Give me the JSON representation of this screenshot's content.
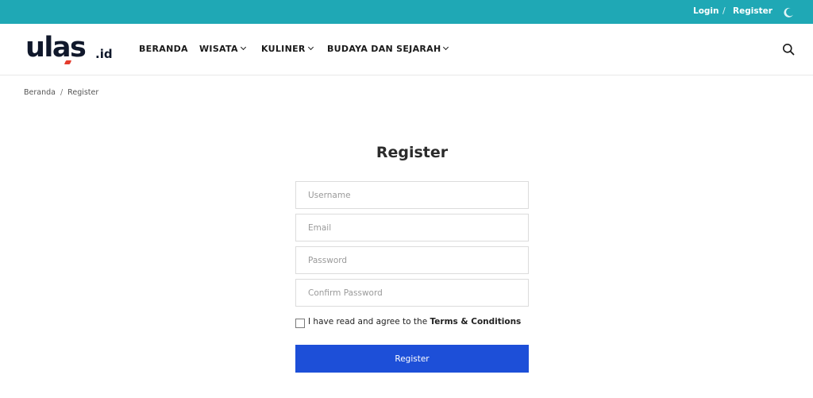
{
  "topbar": {
    "login": "Login",
    "separator": "/",
    "register": "Register",
    "theme_icon": "moon-icon"
  },
  "header": {
    "logo": {
      "main": "ulas",
      "tld": ".id"
    },
    "nav": [
      {
        "label": "BERANDA",
        "dropdown": false
      },
      {
        "label": "WISATA",
        "dropdown": true
      },
      {
        "label": "KULINER",
        "dropdown": true
      },
      {
        "label": "BUDAYA DAN SEJARAH",
        "dropdown": true
      }
    ],
    "search_icon": "search-icon"
  },
  "breadcrumb": {
    "home": "Beranda",
    "separator": "/",
    "current": "Register"
  },
  "form": {
    "title": "Register",
    "username_placeholder": "Username",
    "email_placeholder": "Email",
    "password_placeholder": "Password",
    "confirm_placeholder": "Confirm Password",
    "terms_prefix": "I have read and agree to the ",
    "terms_link": "Terms & Conditions",
    "submit_label": "Register"
  },
  "colors": {
    "topbar": "#1fa8b5",
    "button": "#1d4fd8",
    "logo_accent": "#e43b2c"
  }
}
